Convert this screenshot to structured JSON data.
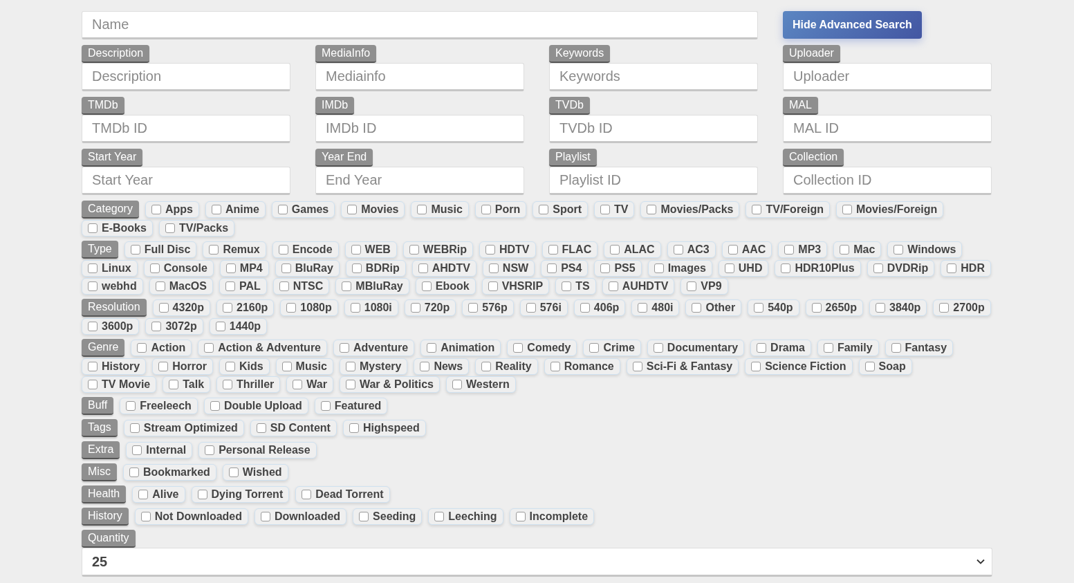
{
  "name_field": {
    "placeholder": "Name"
  },
  "toggle_button": {
    "label": "Hide Advanced Search"
  },
  "fields": [
    {
      "label": "Description",
      "placeholder": "Description"
    },
    {
      "label": "MediaInfo",
      "placeholder": "Mediainfo"
    },
    {
      "label": "Keywords",
      "placeholder": "Keywords"
    },
    {
      "label": "Uploader",
      "placeholder": "Uploader"
    },
    {
      "label": "TMDb",
      "placeholder": "TMDb ID"
    },
    {
      "label": "IMDb",
      "placeholder": "IMDb ID"
    },
    {
      "label": "TVDb",
      "placeholder": "TVDb ID"
    },
    {
      "label": "MAL",
      "placeholder": "MAL ID"
    },
    {
      "label": "Start Year",
      "placeholder": "Start Year"
    },
    {
      "label": "Year End",
      "placeholder": "End Year"
    },
    {
      "label": "Playlist",
      "placeholder": "Playlist ID"
    },
    {
      "label": "Collection",
      "placeholder": "Collection ID"
    }
  ],
  "filters": [
    {
      "label": "Category",
      "options": [
        {
          "label": "Apps",
          "checked": false
        },
        {
          "label": "Anime",
          "checked": false
        },
        {
          "label": "Games",
          "checked": false
        },
        {
          "label": "Movies",
          "checked": false
        },
        {
          "label": "Music",
          "checked": false
        },
        {
          "label": "Porn",
          "checked": false
        },
        {
          "label": "Sport",
          "checked": false
        },
        {
          "label": "TV",
          "checked": false
        },
        {
          "label": "Movies/Packs",
          "checked": false
        },
        {
          "label": "TV/Foreign",
          "checked": false
        },
        {
          "label": "Movies/Foreign",
          "checked": false
        },
        {
          "label": "E-Books",
          "checked": false
        },
        {
          "label": "TV/Packs",
          "checked": false
        }
      ]
    },
    {
      "label": "Type",
      "options": [
        {
          "label": "Full Disc",
          "checked": false
        },
        {
          "label": "Remux",
          "checked": false
        },
        {
          "label": "Encode",
          "checked": false
        },
        {
          "label": "WEB",
          "checked": false
        },
        {
          "label": "WEBRip",
          "checked": false
        },
        {
          "label": "HDTV",
          "checked": false
        },
        {
          "label": "FLAC",
          "checked": false
        },
        {
          "label": "ALAC",
          "checked": false
        },
        {
          "label": "AC3",
          "checked": false
        },
        {
          "label": "AAC",
          "checked": false
        },
        {
          "label": "MP3",
          "checked": false
        },
        {
          "label": "Mac",
          "checked": false
        },
        {
          "label": "Windows",
          "checked": false
        },
        {
          "label": "Linux",
          "checked": false
        },
        {
          "label": "Console",
          "checked": false
        },
        {
          "label": "MP4",
          "checked": false
        },
        {
          "label": "BluRay",
          "checked": false
        },
        {
          "label": "BDRip",
          "checked": false
        },
        {
          "label": "AHDTV",
          "checked": false
        },
        {
          "label": "NSW",
          "checked": false
        },
        {
          "label": "PS4",
          "checked": false
        },
        {
          "label": "PS5",
          "checked": false
        },
        {
          "label": "Images",
          "checked": false
        },
        {
          "label": "UHD",
          "checked": false
        },
        {
          "label": "HDR10Plus",
          "checked": false
        },
        {
          "label": "DVDRip",
          "checked": false
        },
        {
          "label": "HDR",
          "checked": false
        },
        {
          "label": "webhd",
          "checked": false
        },
        {
          "label": "MacOS",
          "checked": false
        },
        {
          "label": "PAL",
          "checked": false
        },
        {
          "label": "NTSC",
          "checked": false
        },
        {
          "label": "MBluRay",
          "checked": false
        },
        {
          "label": "Ebook",
          "checked": false
        },
        {
          "label": "VHSRIP",
          "checked": false
        },
        {
          "label": "TS",
          "checked": false
        },
        {
          "label": "AUHDTV",
          "checked": false
        },
        {
          "label": "VP9",
          "checked": false
        }
      ]
    },
    {
      "label": "Resolution",
      "options": [
        {
          "label": "4320p",
          "checked": false
        },
        {
          "label": "2160p",
          "checked": false
        },
        {
          "label": "1080p",
          "checked": false
        },
        {
          "label": "1080i",
          "checked": false
        },
        {
          "label": "720p",
          "checked": false
        },
        {
          "label": "576p",
          "checked": false
        },
        {
          "label": "576i",
          "checked": false
        },
        {
          "label": "406p",
          "checked": false
        },
        {
          "label": "480i",
          "checked": false
        },
        {
          "label": "Other",
          "checked": false
        },
        {
          "label": "540p",
          "checked": false
        },
        {
          "label": "2650p",
          "checked": false
        },
        {
          "label": "3840p",
          "checked": false
        },
        {
          "label": "2700p",
          "checked": false
        },
        {
          "label": "3600p",
          "checked": false
        },
        {
          "label": "3072p",
          "checked": false
        },
        {
          "label": "1440p",
          "checked": false
        }
      ]
    },
    {
      "label": "Genre",
      "options": [
        {
          "label": "Action",
          "checked": false
        },
        {
          "label": "Action & Adventure",
          "checked": false
        },
        {
          "label": "Adventure",
          "checked": false
        },
        {
          "label": "Animation",
          "checked": false
        },
        {
          "label": "Comedy",
          "checked": false
        },
        {
          "label": "Crime",
          "checked": false
        },
        {
          "label": "Documentary",
          "checked": false
        },
        {
          "label": "Drama",
          "checked": false
        },
        {
          "label": "Family",
          "checked": false
        },
        {
          "label": "Fantasy",
          "checked": false
        },
        {
          "label": "History",
          "checked": false
        },
        {
          "label": "Horror",
          "checked": false
        },
        {
          "label": "Kids",
          "checked": false
        },
        {
          "label": "Music",
          "checked": false
        },
        {
          "label": "Mystery",
          "checked": false
        },
        {
          "label": "News",
          "checked": false
        },
        {
          "label": "Reality",
          "checked": false
        },
        {
          "label": "Romance",
          "checked": false
        },
        {
          "label": "Sci-Fi & Fantasy",
          "checked": false
        },
        {
          "label": "Science Fiction",
          "checked": false
        },
        {
          "label": "Soap",
          "checked": false
        },
        {
          "label": "TV Movie",
          "checked": false
        },
        {
          "label": "Talk",
          "checked": false
        },
        {
          "label": "Thriller",
          "checked": false
        },
        {
          "label": "War",
          "checked": false
        },
        {
          "label": "War & Politics",
          "checked": false
        },
        {
          "label": "Western",
          "checked": false
        }
      ]
    },
    {
      "label": "Buff",
      "options": [
        {
          "label": "Freeleech",
          "checked": false
        },
        {
          "label": "Double Upload",
          "checked": false
        },
        {
          "label": "Featured",
          "checked": false
        }
      ]
    },
    {
      "label": "Tags",
      "options": [
        {
          "label": "Stream Optimized",
          "checked": false
        },
        {
          "label": "SD Content",
          "checked": false
        },
        {
          "label": "Highspeed",
          "checked": false
        }
      ]
    },
    {
      "label": "Extra",
      "options": [
        {
          "label": "Internal",
          "checked": false
        },
        {
          "label": "Personal Release",
          "checked": false
        }
      ]
    },
    {
      "label": "Misc",
      "options": [
        {
          "label": "Bookmarked",
          "checked": false
        },
        {
          "label": "Wished",
          "checked": false
        }
      ]
    },
    {
      "label": "Health",
      "options": [
        {
          "label": "Alive",
          "checked": false
        },
        {
          "label": "Dying Torrent",
          "checked": false
        },
        {
          "label": "Dead Torrent",
          "checked": false
        }
      ]
    },
    {
      "label": "History",
      "options": [
        {
          "label": "Not Downloaded",
          "checked": false
        },
        {
          "label": "Downloaded",
          "checked": false
        },
        {
          "label": "Seeding",
          "checked": false
        },
        {
          "label": "Leeching",
          "checked": false
        },
        {
          "label": "Incomplete",
          "checked": false
        }
      ]
    }
  ],
  "quantity": {
    "label": "Quantity",
    "value": "25"
  }
}
